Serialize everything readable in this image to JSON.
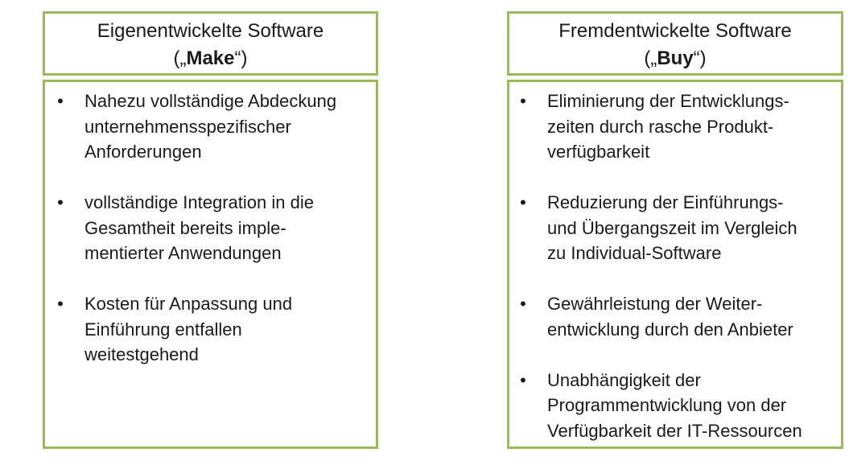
{
  "left": {
    "title": "Eigenentwickelte Software",
    "subtitle_open": "(„",
    "subtitle_bold": "Make",
    "subtitle_close": "“)",
    "items": [
      {
        "bullet": "•",
        "text": "Nahezu vollständige Abdeckung\nunternehmensspezifischer\nAnforderungen"
      },
      {
        "bullet": "•",
        "text": "vollständige Integration in die\nGesamtheit bereits imple-\nmentierter Anwendungen"
      },
      {
        "bullet": "•",
        "text": "Kosten für Anpassung und\nEinführung entfallen\nweitestgehend"
      }
    ]
  },
  "right": {
    "title": "Fremdentwickelte Software",
    "subtitle_open": "(„",
    "subtitle_bold": "Buy",
    "subtitle_close": "“)",
    "items": [
      {
        "bullet": "•",
        "text": "Eliminierung der Entwicklungs-\nzeiten durch rasche Produkt-\nverfügbarkeit"
      },
      {
        "bullet": "•",
        "text": "Reduzierung der Einführungs-\nund Übergangszeit im Vergleich\nzu Individual-Software"
      },
      {
        "bullet": "•",
        "text": "Gewährleistung der Weiter-\nentwicklung durch den Anbieter"
      },
      {
        "bullet": "•",
        "text": "Unabhängigkeit der\nProgrammentwicklung von der\nVerfügbarkeit der IT-Ressourcen"
      }
    ]
  },
  "colors": {
    "border": "#9bbb59",
    "text": "#1a1a1a"
  }
}
